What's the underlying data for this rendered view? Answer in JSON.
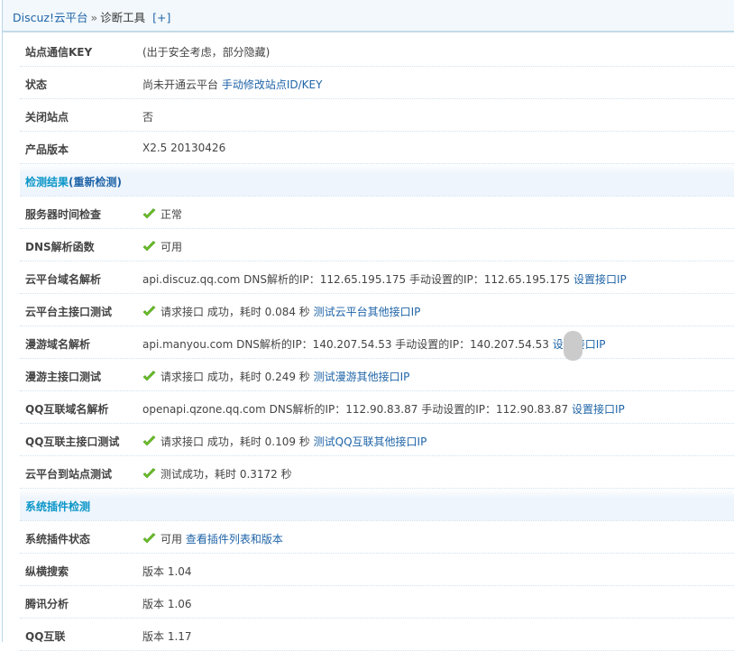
{
  "breadcrumb": {
    "root": "Discuz!云平台",
    "separator": "»",
    "current": "诊断工具",
    "expand": "[+]"
  },
  "rows": [
    {
      "label": "站点通信KEY",
      "text": "(出于安全考虑，部分隐藏)"
    },
    {
      "label": "状态",
      "text": "尚未开通云平台",
      "link": "手动修改站点ID/KEY"
    },
    {
      "label": "关闭站点",
      "text": "否"
    },
    {
      "label": "产品版本",
      "text": "X2.5 20130426"
    },
    {
      "section": true,
      "label": "检测结果",
      "link": "(重新检测)"
    },
    {
      "label": "服务器时间检查",
      "ok": true,
      "text": "正常"
    },
    {
      "label": "DNS解析函数",
      "ok": true,
      "text": "可用"
    },
    {
      "label": "云平台域名解析",
      "text": "api.discuz.qq.com DNS解析的IP：112.65.195.175 手动设置的IP：112.65.195.175",
      "link": "设置接口IP"
    },
    {
      "label": "云平台主接口测试",
      "ok": true,
      "text": "请求接口 成功，耗时 0.084 秒",
      "link": "测试云平台其他接口IP"
    },
    {
      "label": "漫游域名解析",
      "text": "api.manyou.com DNS解析的IP：140.207.54.53 手动设置的IP：140.207.54.53",
      "link": "设置接口IP"
    },
    {
      "label": "漫游主接口测试",
      "ok": true,
      "text": "请求接口 成功，耗时 0.249 秒",
      "link": "测试漫游其他接口IP"
    },
    {
      "label": "QQ互联域名解析",
      "text": "openapi.qzone.qq.com DNS解析的IP：112.90.83.87 手动设置的IP：112.90.83.87",
      "link": "设置接口IP"
    },
    {
      "label": "QQ互联主接口测试",
      "ok": true,
      "text": "请求接口 成功，耗时 0.109 秒",
      "link": "测试QQ互联其他接口IP"
    },
    {
      "label": "云平台到站点测试",
      "ok": true,
      "text": "测试成功，耗时 0.3172 秒"
    },
    {
      "section": true,
      "label": "系统插件检测"
    },
    {
      "label": "系统插件状态",
      "ok": true,
      "text": "可用",
      "link": "查看插件列表和版本"
    },
    {
      "label": "纵横搜索",
      "text": "版本 1.04"
    },
    {
      "label": "腾讯分析",
      "text": "版本 1.06"
    },
    {
      "label": "QQ互联",
      "text": "版本 1.17"
    }
  ],
  "colors": {
    "link": "#1f64a8",
    "section": "#0a96c8",
    "check": "#6cc02a"
  }
}
